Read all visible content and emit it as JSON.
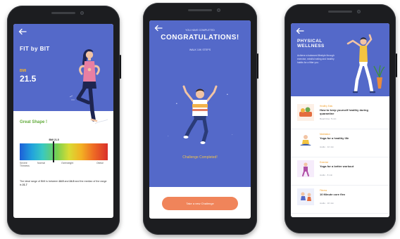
{
  "screen_fit": {
    "title": "FIT by BIT",
    "metric_label": "BMI",
    "metric_value": "21.5",
    "status": "Great Shape !",
    "current_marker": "BMI 21.5",
    "scale_ticks": [
      "Severe\nThinness",
      "Normal",
      "Overweight",
      "Obese"
    ],
    "note_prefix": "The ideal range of BMI is between",
    "range_low": "18.5",
    "range_high": "24.9",
    "note_middle": "and the median of the range is",
    "median": "21.7",
    "bmi_fraction": 0.38
  },
  "screen_congrats": {
    "pre_heading": "YOU HAVE COMPLETED",
    "heading": "CONGRATULATIONS!",
    "subheading": "WALK 10K STEPS",
    "status": "Challenge Completed!",
    "button_label": "Take a new Challenge"
  },
  "screen_wellness": {
    "title": "PHYSICAL WELLNESS",
    "description": "Achieve a balanced lifestyle through exercise, mindful eating and healthy habits for a fitter you.",
    "items": [
      {
        "category": "Healthy Eats",
        "name": "How to keep yourself healthy during quarantine",
        "meta": "Read time: 5 min"
      },
      {
        "category": "Meditation",
        "name": "Yoga for a healthy life",
        "meta": "Audio · 12 min"
      },
      {
        "category": "Exercise",
        "name": "Yoga for a better workout",
        "meta": "Audio · 8 min"
      },
      {
        "category": "Fitness",
        "name": "10 Minute core flex",
        "meta": "Audio · 10 min"
      }
    ]
  },
  "colors": {
    "header_blue": "#5469c9",
    "accent_orange": "#f0845a",
    "status_green": "#63ab3c",
    "metric_yellow": "#f5b42c"
  }
}
